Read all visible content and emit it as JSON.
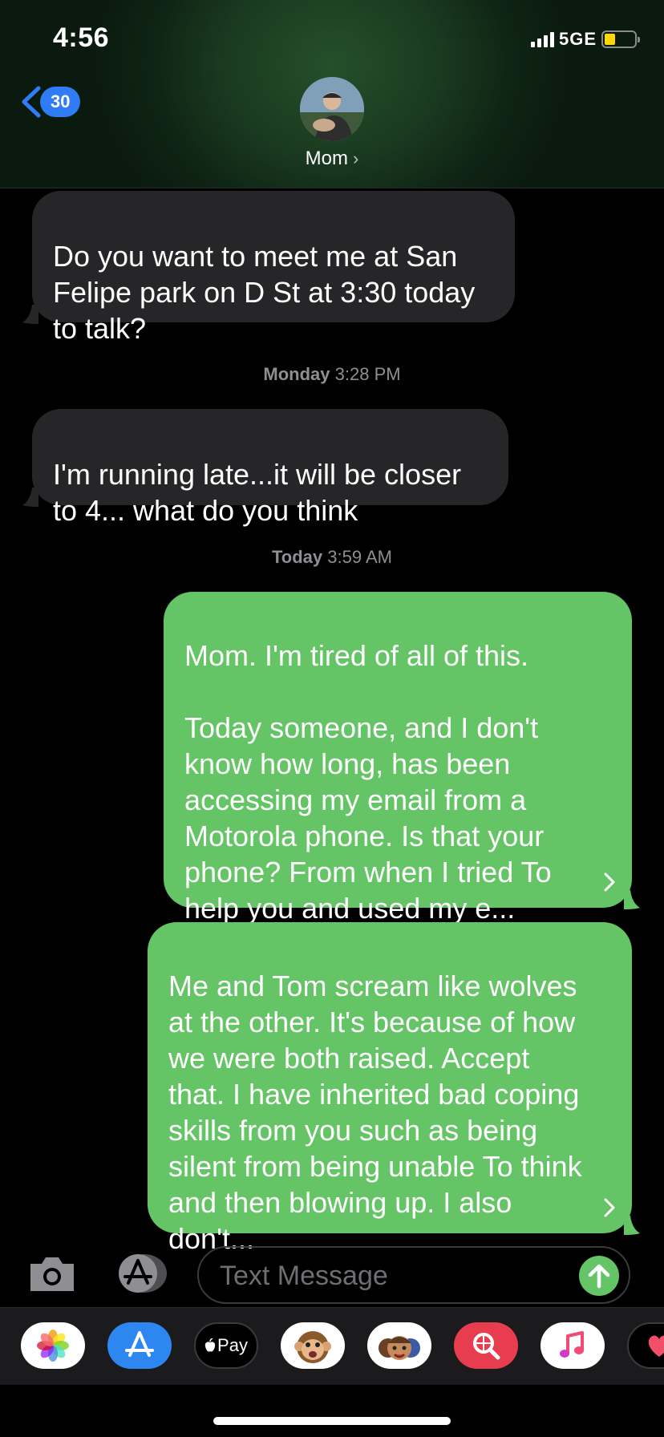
{
  "status_bar": {
    "time": "4:56",
    "network": "5GE"
  },
  "header": {
    "back_count": "30",
    "contact_name": "Mom",
    "contact_chevron": "›"
  },
  "messages": [
    {
      "type": "received",
      "text": "Do you want to meet me at San Felipe park on D St at 3:30 today to talk?"
    },
    {
      "type": "timestamp",
      "day": "Monday",
      "time": "3:28 PM"
    },
    {
      "type": "received",
      "text": "I'm running late...it will be closer to 4... what do you think"
    },
    {
      "type": "timestamp",
      "day": "Today",
      "time": "3:59 AM"
    },
    {
      "type": "sent",
      "text": "Mom. I'm tired of all of this.\n\nToday someone, and I don't know how long, has been accessing my email from a Motorola phone. Is that your phone? From when I tried To help you and used my e..."
    },
    {
      "type": "sent",
      "text": "Me and Tom scream like wolves at the other. It's because of how we were both raised. Accept that. I have inherited bad coping skills from you such as being silent from being unable To think and then blowing up. I also don't..."
    }
  ],
  "composer": {
    "placeholder": "Text Message"
  },
  "app_tray": [
    {
      "name": "photos-icon"
    },
    {
      "name": "app-store-icon"
    },
    {
      "name": "apple-pay-icon",
      "label": "Pay"
    },
    {
      "name": "animoji-icon"
    },
    {
      "name": "memoji-icon"
    },
    {
      "name": "images-search-icon"
    },
    {
      "name": "music-icon"
    },
    {
      "name": "digital-touch-icon"
    }
  ],
  "colors": {
    "sent_bubble": "#65c466",
    "received_bubble": "#262628",
    "accent": "#2f7cf6",
    "battery": "#ffd60a"
  }
}
